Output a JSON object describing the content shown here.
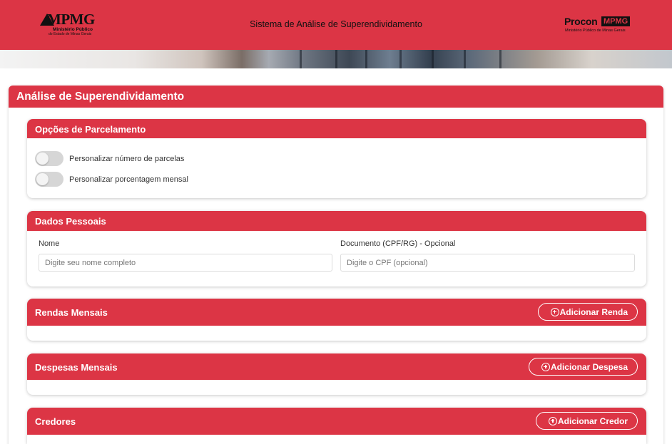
{
  "header": {
    "logo_left": {
      "word": "MPMG",
      "line1": "Ministério Público",
      "line2": "do Estado de Minas Gerais"
    },
    "title": "Sistema de Análise de Superendividamento",
    "logo_right": {
      "procon": "Procon",
      "mpmg": "MPMG",
      "sub": "Ministério Público de Minas Gerais"
    }
  },
  "main": {
    "title": "Análise de Superendividamento",
    "parcelamento": {
      "title": "Opções de Parcelamento",
      "toggles": [
        {
          "label": "Personalizar número de parcelas",
          "on": false
        },
        {
          "label": "Personalizar porcentagem mensal",
          "on": false
        }
      ]
    },
    "dados_pessoais": {
      "title": "Dados Pessoais",
      "nome_label": "Nome",
      "nome_placeholder": "Digite seu nome completo",
      "doc_label": "Documento (CPF/RG) - Opcional",
      "doc_placeholder": "Digite o CPF (opcional)"
    },
    "rendas": {
      "title": "Rendas Mensais",
      "button": "Adicionar Renda"
    },
    "despesas": {
      "title": "Despesas Mensais",
      "button": "Adicionar Despesa"
    },
    "credores": {
      "title": "Credores",
      "button": "Adicionar Credor"
    }
  },
  "colors": {
    "brand_red": "#dc3545",
    "toggle_off": "#d6d6d6"
  }
}
